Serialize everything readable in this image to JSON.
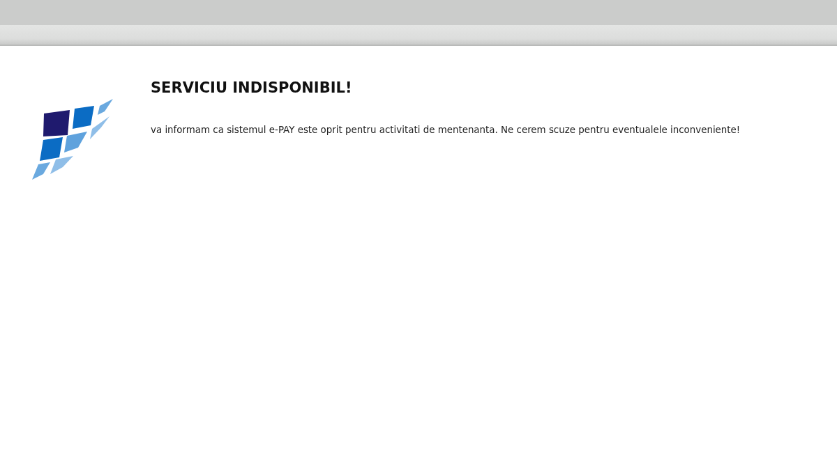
{
  "page": {
    "title": "SERVICIU INDISPONIBIL!",
    "message": "va informam ca sistemul e-PAY este oprit pentru activitati de mentenanta. Ne cerem scuze pentru eventualele inconveniente!"
  }
}
